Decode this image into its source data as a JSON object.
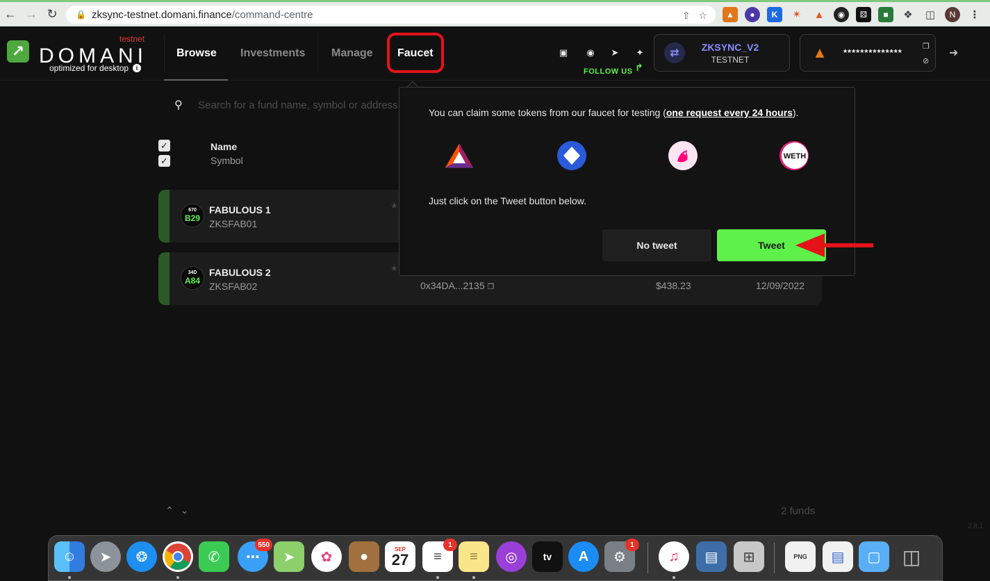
{
  "browser": {
    "url_host": "zksync-testnet.domani.finance",
    "url_path": "/command-centre",
    "profile_initial": "N"
  },
  "app": {
    "logo_text": "DOMANI",
    "env_label": "testnet",
    "tagline": "optimized for desktop",
    "nav": {
      "browse": "Browse",
      "investments": "Investments",
      "manage": "Manage",
      "faucet": "Faucet"
    },
    "follow_us": "FOLLOW US",
    "network": {
      "name": "ZKSYNC_V2",
      "sub": "TESTNET"
    },
    "wallet": {
      "address_masked": "**************"
    }
  },
  "search": {
    "placeholder": "Search for a fund name, symbol or address"
  },
  "table": {
    "col_name": "Name",
    "col_symbol": "Symbol",
    "rows": [
      {
        "badge_top": "670",
        "badge_bottom": "B29",
        "name": "FABULOUS 1",
        "symbol": "ZKSFAB01",
        "address": "",
        "value": "",
        "date": ""
      },
      {
        "badge_top": "34D",
        "badge_bottom": "A84",
        "name": "FABULOUS 2",
        "symbol": "ZKSFAB02",
        "address": "0x34DA...2135",
        "value": "$438.23",
        "date": "12/09/2022"
      }
    ],
    "fund_count": "2 funds"
  },
  "faucet_popup": {
    "text_before": "You can claim some tokens from our faucet for testing (",
    "text_link": "one request every 24 hours",
    "text_after": ").",
    "hint": "Just click on the Tweet button below.",
    "no_tweet_label": "No tweet",
    "tweet_label": "Tweet",
    "tokens": [
      "BAT",
      "LINK",
      "UNI",
      "WETH"
    ],
    "weth_label": "WETH"
  },
  "dock": {
    "messages_badge": "550",
    "calendar_month": "SEP",
    "calendar_day": "27",
    "reminders_badge": "1",
    "prefs_badge": "1",
    "tv_label": "tv",
    "preview_label": "PNG"
  },
  "version": "2.8.1",
  "colors": {
    "accent_green": "#5ef14a",
    "highlight_red": "#e3131a",
    "zksync_purple": "#8c8dfc"
  }
}
